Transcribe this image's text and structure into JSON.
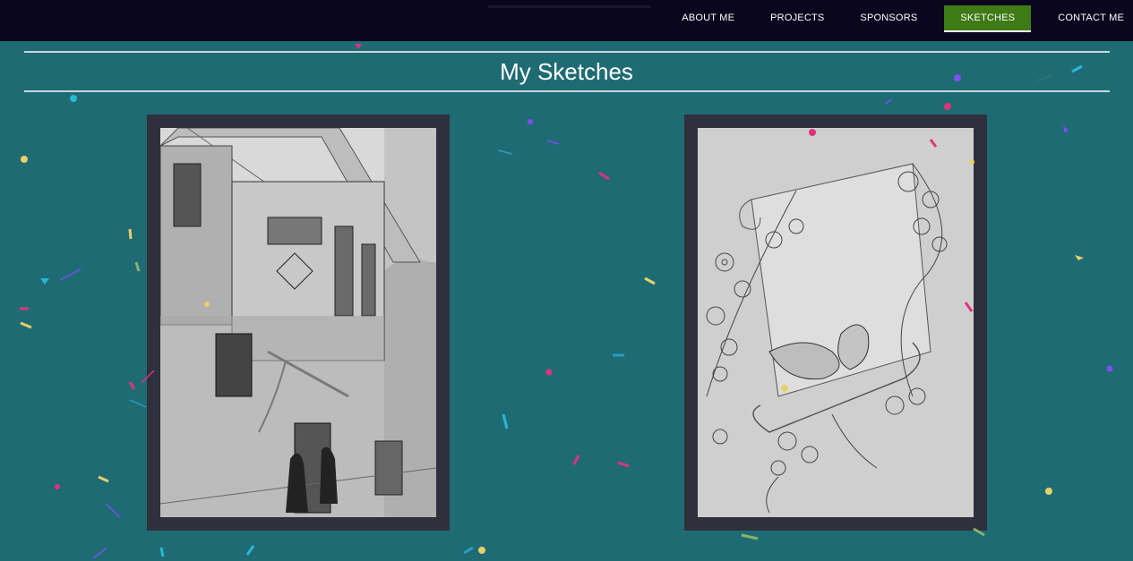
{
  "nav": {
    "items": [
      {
        "label": "ABOUT ME"
      },
      {
        "label": "PROJECTS"
      },
      {
        "label": "SPONSORS"
      },
      {
        "label": "SKETCHES",
        "active": true
      },
      {
        "label": "CONTACT ME"
      }
    ]
  },
  "page": {
    "title": "My Sketches"
  },
  "colors": {
    "background": "#1f6b74",
    "topbar": "#0a061e",
    "active_nav": "#3e7a16",
    "frame": "#302f3c"
  },
  "sketches": [
    {
      "subject": "pencil sketch of old wooden house with two figures"
    },
    {
      "subject": "pencil sketch of two birds on scroll with flowers"
    }
  ]
}
